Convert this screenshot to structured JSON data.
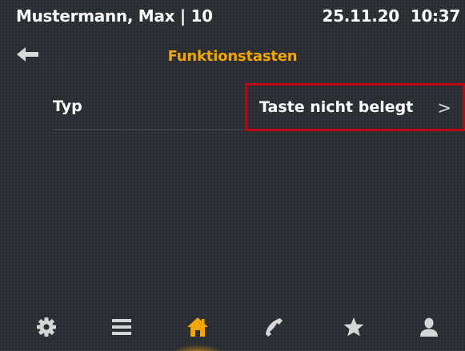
{
  "status_bar": {
    "user": "Mustermann, Max | 10",
    "date": "25.11.20",
    "time": "10:37"
  },
  "header": {
    "back_icon": "back-arrow-icon",
    "title": "Funktionstasten"
  },
  "settings": {
    "type_label": "Typ",
    "type_value": "Taste nicht belegt",
    "chevron": ">"
  },
  "bottom_nav": {
    "items": [
      {
        "icon": "gear-icon",
        "active": false
      },
      {
        "icon": "menu-icon",
        "active": false
      },
      {
        "icon": "home-icon",
        "active": true
      },
      {
        "icon": "phone-icon",
        "active": false
      },
      {
        "icon": "star-icon",
        "active": false
      },
      {
        "icon": "person-icon",
        "active": false
      }
    ]
  },
  "colors": {
    "background": "#2b2f33",
    "title": "#f5a400",
    "highlight_border": "#c00012",
    "icon_default": "#d6d6d6",
    "icon_active": "#f5a400"
  }
}
